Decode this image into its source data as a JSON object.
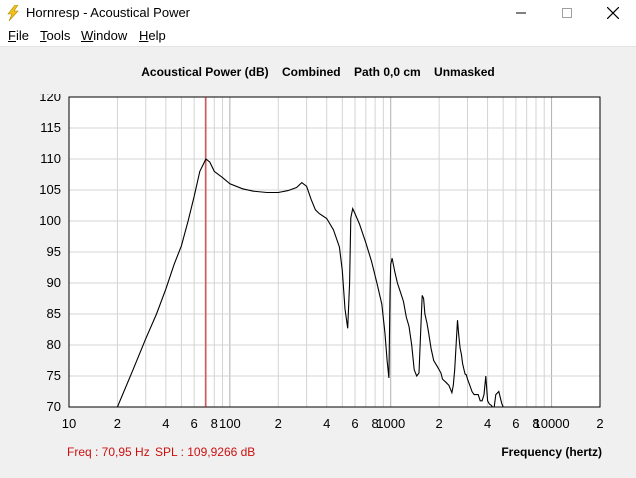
{
  "window": {
    "title": "Hornresp - Acoustical Power",
    "icon": "lightning-bolt-icon",
    "controls": [
      "minimize-icon",
      "maximize-icon",
      "close-icon"
    ]
  },
  "menu": {
    "items": [
      {
        "label": "File",
        "accel": "F",
        "rest": "ile"
      },
      {
        "label": "Tools",
        "accel": "T",
        "rest": "ools"
      },
      {
        "label": "Window",
        "accel": "W",
        "rest": "indow"
      },
      {
        "label": "Help",
        "accel": "H",
        "rest": "elp"
      }
    ]
  },
  "header": {
    "quantity": "Acoustical Power (dB)",
    "mode": "Combined",
    "path": "Path 0,0 cm",
    "mask": "Unmasked"
  },
  "readout": {
    "freq": "Freq : 70,95 Hz",
    "spl": "SPL : 109,9266 dB"
  },
  "colors": {
    "curve": "#000000",
    "cursor": "#cc1010",
    "grid": "#d4d4d4",
    "grid_major": "#b0b0b0",
    "readout": "#cc1010"
  },
  "chart_data": {
    "type": "line",
    "x_scale": "log",
    "xlim": [
      10,
      20000
    ],
    "ylim": [
      70,
      120
    ],
    "xlabel": "Frequency (hertz)",
    "ylabel": "",
    "grid": true,
    "y_ticks": [
      "120",
      "115",
      "110",
      "105",
      "100",
      "95",
      "90",
      "85",
      "80",
      "75",
      "70"
    ],
    "x_ticks": [
      {
        "v": 10,
        "label": "10"
      },
      {
        "v": 20,
        "label": "2"
      },
      {
        "v": 40,
        "label": "4"
      },
      {
        "v": 60,
        "label": "6"
      },
      {
        "v": 80,
        "label": "8"
      },
      {
        "v": 100,
        "label": "100"
      },
      {
        "v": 200,
        "label": "2"
      },
      {
        "v": 400,
        "label": "4"
      },
      {
        "v": 600,
        "label": "6"
      },
      {
        "v": 800,
        "label": "8"
      },
      {
        "v": 1000,
        "label": "1000"
      },
      {
        "v": 2000,
        "label": "2"
      },
      {
        "v": 4000,
        "label": "4"
      },
      {
        "v": 6000,
        "label": "6"
      },
      {
        "v": 8000,
        "label": "8"
      },
      {
        "v": 10000,
        "label": "10000"
      },
      {
        "v": 20000,
        "label": "2"
      }
    ],
    "cursor_x": 70.95,
    "series": [
      {
        "x": [
          20,
          25,
          30,
          35,
          40,
          45,
          50,
          55,
          60,
          65,
          70.95,
          75,
          80,
          90,
          100,
          120,
          140,
          170,
          200,
          230,
          260,
          280,
          300,
          320,
          340,
          360,
          400,
          440,
          480,
          500,
          520,
          540,
          555,
          565,
          580,
          600,
          640,
          700,
          760,
          820,
          880,
          920,
          950,
          975,
          990,
          1000,
          1020,
          1060,
          1100,
          1150,
          1200,
          1250,
          1300,
          1350,
          1400,
          1450,
          1500,
          1540,
          1570,
          1600,
          1630,
          1680,
          1720,
          1780,
          1850,
          1950,
          2050,
          2100,
          2200,
          2300,
          2400,
          2450,
          2500,
          2550,
          2600,
          2650,
          2700,
          2750,
          2800,
          2850,
          2900,
          2950,
          3000,
          3100,
          3200,
          3300,
          3400,
          3500,
          3550,
          3600,
          3700,
          3800,
          3900,
          4000,
          4100,
          4200,
          4300,
          4400,
          4500,
          4700,
          4900,
          5000
        ],
        "y": [
          70,
          76,
          81,
          85,
          89,
          93,
          96,
          100,
          104,
          108,
          110,
          109.5,
          108,
          107,
          106,
          105.2,
          104.8,
          104.6,
          104.6,
          104.9,
          105.4,
          106.2,
          105.6,
          103.5,
          101.8,
          101.2,
          100.4,
          98.6,
          95.8,
          92,
          85.8,
          82.7,
          90,
          100.5,
          102,
          101.2,
          99.5,
          96.5,
          93.5,
          90,
          86.6,
          82,
          77.5,
          74.7,
          88,
          93,
          94,
          91.8,
          90,
          88.5,
          87,
          84.5,
          83,
          80,
          76,
          75,
          75.5,
          83,
          88,
          87.5,
          85,
          83.5,
          82,
          79.5,
          77.5,
          76.5,
          75.5,
          74.5,
          74,
          73.5,
          72.3,
          73.5,
          76,
          80,
          84,
          81.5,
          79.5,
          78.5,
          77,
          76.1,
          75.3,
          75.2,
          74.5,
          73.5,
          72.5,
          72,
          72,
          72,
          71.5,
          71,
          71,
          72,
          75,
          71,
          70.5,
          70.3,
          70,
          70,
          72,
          72.5,
          70.6,
          70
        ]
      }
    ]
  }
}
